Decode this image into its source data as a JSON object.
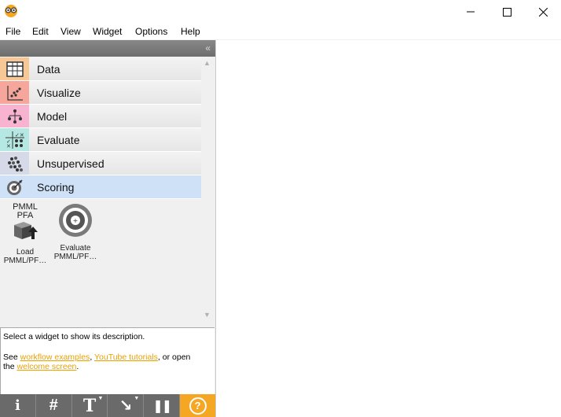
{
  "window": {
    "min_glyph": "—",
    "max_glyph": "☐",
    "close_glyph": "✕"
  },
  "menu": [
    {
      "label": "File"
    },
    {
      "label": "Edit"
    },
    {
      "label": "View"
    },
    {
      "label": "Widget"
    },
    {
      "label": "Options"
    },
    {
      "label": "Help"
    }
  ],
  "panel": {
    "collapse_glyph": "«"
  },
  "categories": [
    {
      "label": "Data",
      "icon": "data-table-icon",
      "color": "#f7c896"
    },
    {
      "label": "Visualize",
      "icon": "scatter-plot-icon",
      "color": "#f6a69b"
    },
    {
      "label": "Model",
      "icon": "tree-model-icon",
      "color": "#f7b3d0"
    },
    {
      "label": "Evaluate",
      "icon": "evaluate-grid-icon",
      "color": "#b5e8e2"
    },
    {
      "label": "Unsupervised",
      "icon": "cluster-dots-icon",
      "color": "#d5d9e8"
    },
    {
      "label": "Scoring",
      "icon": "target-icon",
      "color": "#cfe1f7",
      "selected": true
    }
  ],
  "widgets": [
    {
      "top": "PMML",
      "sub": "PFA",
      "label": "Load\nPMML/PF…",
      "icon": "load-package-icon"
    },
    {
      "label": "Evaluate\nPMML/PF…",
      "icon": "evaluate-disc-icon"
    }
  ],
  "description": {
    "line1": "Select a widget to show its description.",
    "see": "See ",
    "link1": "workflow examples",
    "comma": ", ",
    "link2": "YouTube tutorials",
    "or_open": ", or open",
    "the": "the ",
    "link3": "welcome screen",
    "dot": "."
  },
  "toolbar": {
    "info": "i",
    "grid": "#",
    "text": "T",
    "arrow": "↘",
    "pause": "❚❚",
    "help": "?"
  },
  "colors": {
    "accent": "#f5a623",
    "link": "#e8a100",
    "selected": "#cfe1f7"
  }
}
